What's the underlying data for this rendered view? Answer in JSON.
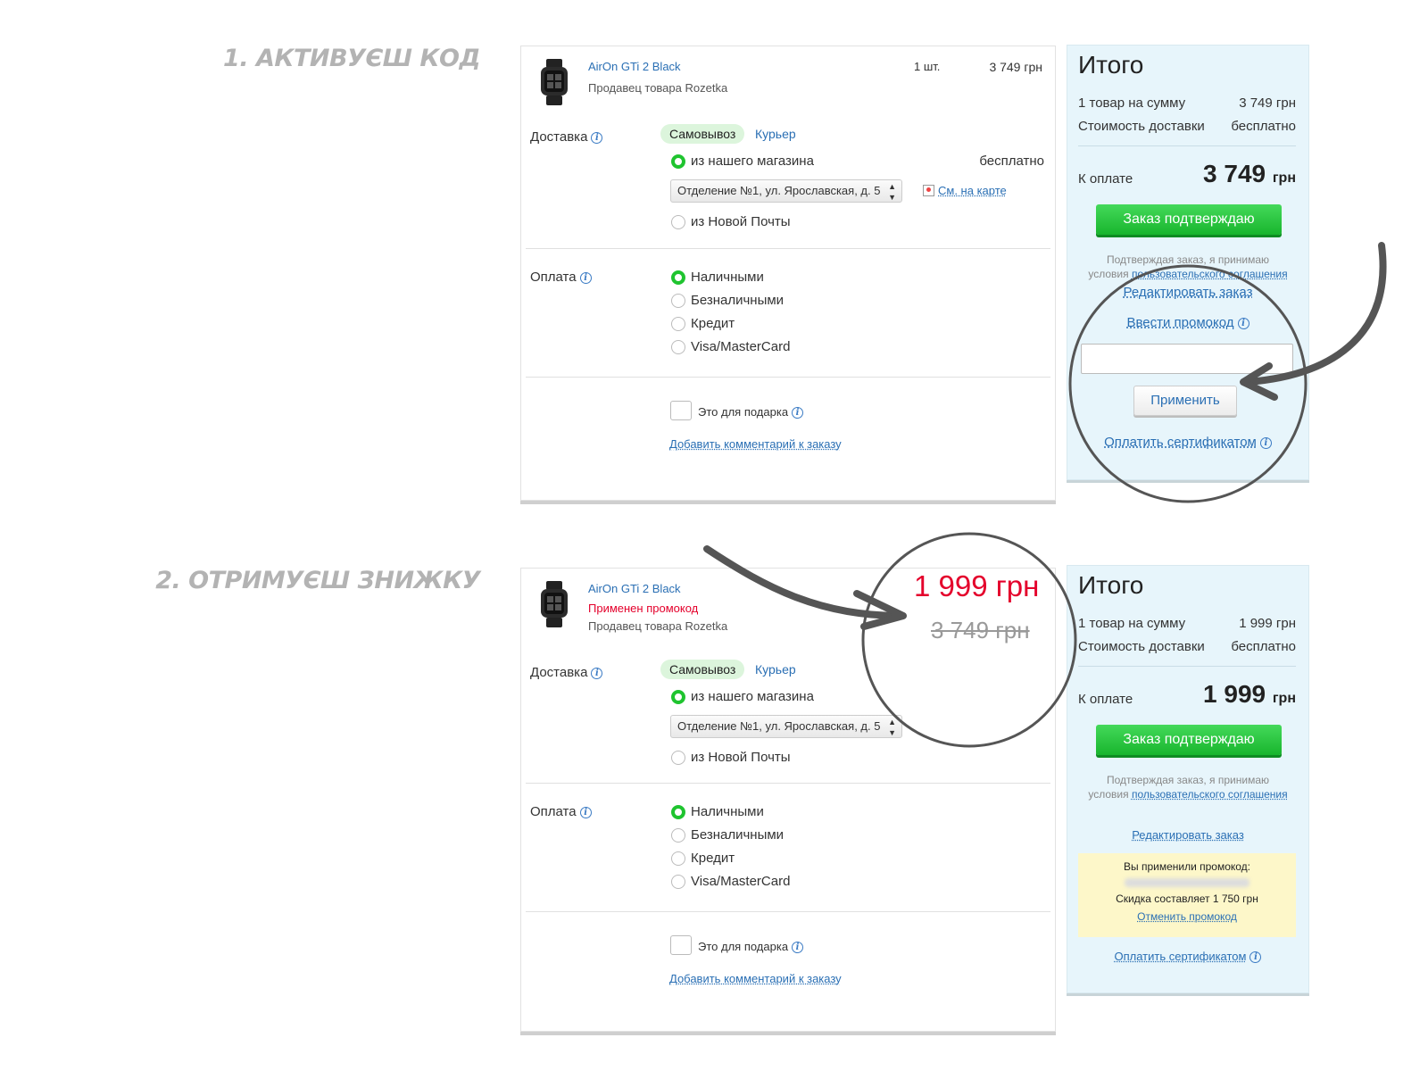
{
  "steps": {
    "step1": "1. АКТИВУЄШ КОД",
    "step2": "2. ОТРИМУЄШ ЗНИЖКУ"
  },
  "order1": {
    "product_name": "AirOn GTi 2 Black",
    "seller": "Продавец товара  Rozetka",
    "qty": "1 шт.",
    "price": "3 749 грн",
    "delivery_label": "Доставка",
    "pickup": "Самовывоз",
    "courier": "Курьер",
    "from_store": "из нашего магазина",
    "free": "бесплатно",
    "branch": "Отделение №1, ул. Ярославская, д. 5",
    "map_link": "См. на карте",
    "nova_poshta": "из Новой Почты",
    "payment_label": "Оплата",
    "pay_cash": "Наличными",
    "pay_cashless": "Безналичными",
    "pay_credit": "Кредит",
    "pay_card": "Visa/MasterCard",
    "gift": "Это для подарка",
    "add_comment": "Добавить комментарий к заказу"
  },
  "summary1": {
    "title": "Итого",
    "items_label": "1 товар на сумму",
    "items_value": "3 749 грн",
    "delivery_label": "Стоимость доставки",
    "delivery_value": "бесплатно",
    "to_pay_label": "К оплате",
    "to_pay_value": "3 749",
    "currency": "грн",
    "confirm": "Заказ подтверждаю",
    "terms_prefix": "Подтверждая заказ, я принимаю",
    "terms_middle": "условия",
    "terms_link": "пользовательского соглашения",
    "edit": "Редактировать заказ",
    "enter_promo": "Ввести промокод",
    "apply": "Применить",
    "certificate": "Оплатить сертификатом"
  },
  "order2": {
    "product_name": "AirOn GTi 2 Black",
    "promo_applied": "Применен промокод",
    "seller": "Продавец товара  Rozetka",
    "new_price": "1 999 грн",
    "old_price": "3 749 грн",
    "delivery_label": "Доставка",
    "pickup": "Самовывоз",
    "courier": "Курьер",
    "from_store": "из нашего магазина",
    "branch": "Отделение №1, ул. Ярославская, д. 5",
    "nova_poshta": "из Новой Почты",
    "payment_label": "Оплата",
    "pay_cash": "Наличными",
    "pay_cashless": "Безналичными",
    "pay_credit": "Кредит",
    "pay_card": "Visa/MasterCard",
    "gift": "Это для подарка",
    "add_comment": "Добавить комментарий к заказу"
  },
  "summary2": {
    "title": "Итого",
    "items_label": "1 товар на сумму",
    "items_value": "1 999 грн",
    "delivery_label": "Стоимость доставки",
    "delivery_value": "бесплатно",
    "to_pay_label": "К оплате",
    "to_pay_value": "1 999",
    "currency": "грн",
    "confirm": "Заказ подтверждаю",
    "terms_prefix": "Подтверждая заказ, я принимаю",
    "terms_middle": "условия",
    "terms_link": "пользовательского соглашения",
    "edit": "Редактировать заказ",
    "promo_used": "Вы применили промокод:",
    "discount": "Скидка составляет 1 750 грн",
    "cancel_promo": "Отменить промокод",
    "certificate": "Оплатить сертификатом"
  },
  "colors": {
    "accent_blue": "#2a6fb4",
    "confirm_green": "#18b52d",
    "price_red": "#e4002b",
    "summary_bg": "#e7f5fb",
    "promo_box_bg": "#fdf7c9"
  },
  "icons": [
    "watch-product-icon",
    "info-icon",
    "map-icon",
    "select-arrows-icon"
  ]
}
